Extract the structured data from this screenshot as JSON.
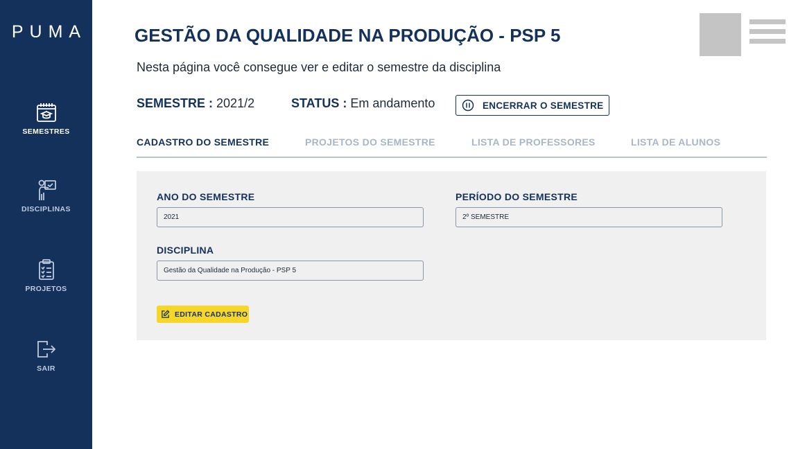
{
  "sidebar": {
    "logo": "PUMA",
    "items": [
      {
        "label": "SEMESTRES",
        "icon": "calendar-graduation-icon"
      },
      {
        "label": "DISCIPLINAS",
        "icon": "teacher-board-icon"
      },
      {
        "label": "PROJETOS",
        "icon": "clipboard-checklist-icon"
      },
      {
        "label": "SAIR",
        "icon": "logout-icon"
      }
    ]
  },
  "header": {
    "title": "GESTÃO DA QUALIDADE NA PRODUÇÃO - PSP 5",
    "subtitle": "Nesta página você consegue ver e editar o semestre da disciplina"
  },
  "info": {
    "semester_label": "SEMESTRE :",
    "semester_value": "2021/2",
    "status_label": "STATUS :",
    "status_value": "Em andamento",
    "end_button": "ENCERRAR O SEMESTRE"
  },
  "tabs": [
    {
      "label": "CADASTRO DO SEMESTRE",
      "active": true
    },
    {
      "label": "PROJETOS DO SEMESTRE",
      "active": false
    },
    {
      "label": "LISTA DE PROFESSORES",
      "active": false
    },
    {
      "label": "LISTA DE ALUNOS",
      "active": false
    }
  ],
  "form": {
    "year_label": "ANO DO SEMESTRE",
    "year_value": "2021",
    "period_label": "PERÍODO DO SEMESTRE",
    "period_value": "2º SEMESTRE",
    "discipline_label": "DISCIPLINA",
    "discipline_value": "Gestão da Qualidade na Produção - PSP 5",
    "edit_button": "EDITAR CADASTRO"
  },
  "colors": {
    "sidebar_bg": "#14315b",
    "primary_text": "#14315b",
    "inactive_tab": "#a9b6c7",
    "card_bg": "#f0f0f0",
    "edit_button_bg": "#f6d729",
    "placeholder_gray": "#c4c4c4"
  }
}
